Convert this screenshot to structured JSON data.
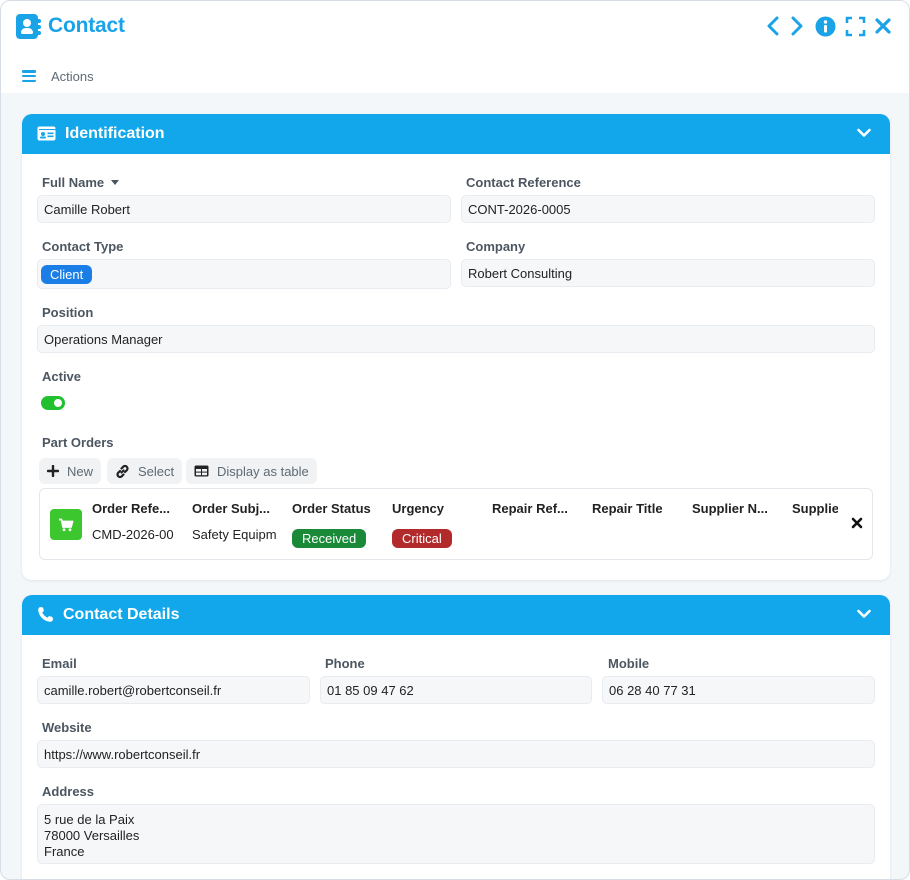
{
  "window": {
    "title": "Contact"
  },
  "toolbar": {
    "prev_icon": "chevron-left-icon",
    "next_icon": "chevron-right-icon",
    "info_icon": "info-icon",
    "fullscreen_icon": "fullscreen-icon",
    "close_icon": "close-icon"
  },
  "actions": {
    "label": "Actions"
  },
  "colors": {
    "accent": "#1aa3e6",
    "header": "#12a7eb",
    "badge_client": "#1a7ee6",
    "badge_received": "#1a8a38",
    "badge_critical": "#b32a2a",
    "toggle_on": "#22c02f",
    "cart": "#3cc72f"
  },
  "identification": {
    "title": "Identification",
    "full_name": {
      "label": "Full Name",
      "value": "Camille Robert"
    },
    "contact_reference": {
      "label": "Contact Reference",
      "value": "CONT-2026-0005"
    },
    "contact_type": {
      "label": "Contact Type",
      "value": "Client"
    },
    "company": {
      "label": "Company",
      "value": "Robert Consulting"
    },
    "position": {
      "label": "Position",
      "value": "Operations Manager"
    },
    "active": {
      "label": "Active",
      "value": true
    },
    "part_orders": {
      "label": "Part Orders",
      "buttons": {
        "new": "New",
        "select": "Select",
        "display_table": "Display as table"
      },
      "columns": [
        "Order Refe...",
        "Order Subj...",
        "Order Status",
        "Urgency",
        "Repair Ref...",
        "Repair Title",
        "Supplier N...",
        "Supplie"
      ],
      "row": {
        "order_reference": "CMD-2026-00",
        "order_subject": "Safety Equipm",
        "order_status": "Received",
        "urgency": "Critical"
      }
    }
  },
  "contact_details": {
    "title": "Contact Details",
    "email": {
      "label": "Email",
      "value": "camille.robert@robertconseil.fr"
    },
    "phone": {
      "label": "Phone",
      "value": "01 85 09 47 62"
    },
    "mobile": {
      "label": "Mobile",
      "value": "06 28 40 77 31"
    },
    "website": {
      "label": "Website",
      "value": "https://www.robertconseil.fr"
    },
    "address": {
      "label": "Address",
      "lines": [
        "5 rue de la Paix",
        "78000 Versailles",
        "France"
      ]
    }
  }
}
